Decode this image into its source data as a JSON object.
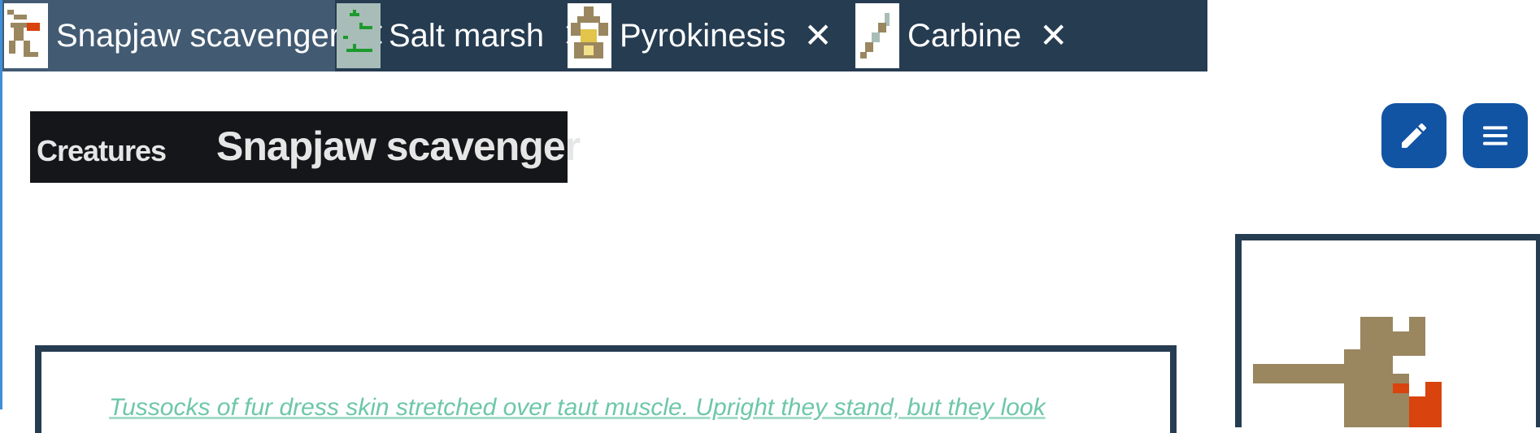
{
  "tabs": [
    {
      "label": "Snapjaw scavenger",
      "icon": "snapjaw-thumbnail-icon",
      "close_icon": "close-icon",
      "active": true
    },
    {
      "label": "Salt marsh",
      "icon": "salt-marsh-thumbnail-icon",
      "close_icon": "close-icon",
      "active": false
    },
    {
      "label": "Pyrokinesis",
      "icon": "pyrokinesis-thumbnail-icon",
      "close_icon": "close-icon",
      "active": false
    },
    {
      "label": "Carbine",
      "icon": "carbine-thumbnail-icon",
      "close_icon": "close-icon",
      "active": false
    }
  ],
  "close_glyph": "✕",
  "header": {
    "category": "Creatures",
    "title": "Snapjaw scavenger"
  },
  "actions": {
    "edit_icon": "pencil-icon",
    "menu_icon": "hamburger-menu-icon"
  },
  "description": {
    "text": "Tussocks of fur dress skin stretched over taut muscle. Upright they stand, but they look"
  },
  "sprite": {
    "icon": "snapjaw-sprite-icon"
  },
  "colors": {
    "tab_bar": "#263c51",
    "tab_active": "#425b73",
    "title_bg": "#151619",
    "button_blue": "#1254a4",
    "panel_border": "#263c51",
    "description_text": "#6dc7a8",
    "sprite_tan": "#9a8760",
    "sprite_orange": "#d9430d"
  }
}
